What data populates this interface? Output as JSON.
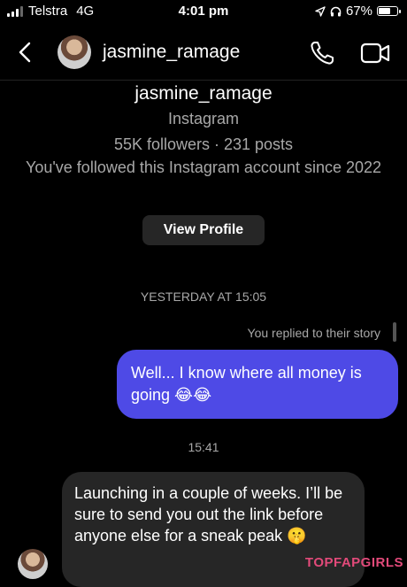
{
  "status_bar": {
    "carrier": "Telstra",
    "network": "4G",
    "time": "4:01 pm",
    "battery": "67%",
    "battery_level": 0.67
  },
  "header": {
    "username": "jasmine_ramage",
    "icons": [
      "back-icon",
      "avatar",
      "phone-icon",
      "video-camera-icon"
    ]
  },
  "profile": {
    "name": "jasmine_ramage",
    "platform": "Instagram",
    "stats": "55K followers · 231 posts",
    "since": "You've followed this Instagram account since 2022",
    "view_profile_label": "View Profile"
  },
  "conversation": {
    "date_separator": "YESTERDAY AT 15:05",
    "replied_note": "You replied to their story",
    "outgoing_message": "Well... I know where all money is going 😂😂",
    "time_separator": "15:41",
    "incoming_message": "Launching in a couple of weeks. I’ll be sure to send you out the link before anyone else for a sneak peak 🤫"
  },
  "watermark": "TOPFAPGIRLS"
}
